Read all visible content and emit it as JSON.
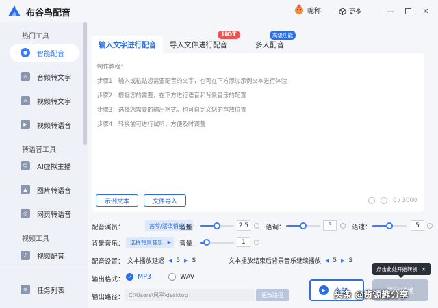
{
  "app": {
    "title": "布谷鸟配音"
  },
  "header": {
    "user_name": "昵称",
    "more_label": "更多"
  },
  "sidebar": {
    "groups": [
      {
        "title": "热门工具",
        "items": [
          "智能配音",
          "音频转文字",
          "视频转文字",
          "视频转语音"
        ]
      },
      {
        "title": "转语音工具",
        "items": [
          "AI虚拟主播",
          "图片转语音",
          "网页转语音"
        ]
      },
      {
        "title": "视频工具",
        "items": [
          "视频配音"
        ]
      }
    ],
    "bottom_item": "任务列表",
    "active_item": "智能配音"
  },
  "tabs": {
    "items": [
      "输入文字进行配音",
      "导入文件进行配音",
      "多人配音"
    ],
    "active": "输入文字进行配音",
    "hot_badge": "HOT",
    "advanced_badge": "高级功能"
  },
  "editor": {
    "tutorial": [
      "制作教程：",
      "步骤1：输入或粘贴您需要配音的文字，也可在下方添加示例文本进行体验",
      "步骤2：根据您的需要，在下方进行语音和背景音乐的配置",
      "步骤3：选择您需要的输出格式，也可自定义您的存放位置",
      "步骤4：转换前可进行试听，方便及时调整"
    ],
    "sample_button": "示例文本",
    "import_button": "文件导入",
    "char_count": "0 / 3000"
  },
  "settings": {
    "voice_label": "配音演员：",
    "voice_value": "茜兮/活泼俏皮",
    "volume_label": "音量：",
    "volume_value": "2.5",
    "volume_level": 0.5,
    "tone_label": "语调：",
    "tone_value": "5",
    "tone_level": 0.5,
    "speed_label": "语速：",
    "speed_value": "5",
    "speed_level": 0.5,
    "bgm_label": "背景音乐：",
    "bgm_value": "选择背景音乐",
    "bgm_volume_label": "音量：",
    "bgm_volume_value": "1",
    "bgm_volume_level": 0.2,
    "config_label": "配音设置：",
    "start_delay_label": "文本播放延迟",
    "start_delay_value": "5",
    "end_delay_label": "文本播放结束后背景音乐继续播放",
    "end_delay_value": "5",
    "unit": "S",
    "format_label": "输出格式：",
    "format_options": [
      "MP3",
      "WAV"
    ],
    "format_selected": "MP3",
    "path_label": "输出路径：",
    "path_value": "C:\\Users\\风平\\desktop",
    "path_button": "更改路径"
  },
  "actions": {
    "play_all": "全部",
    "start": "开始转换",
    "tooltip": "点击此处开始转换"
  },
  "watermark": "头条 @资源趣分享",
  "colors": {
    "accent": "#2b6fe8",
    "hot": "#f0524f"
  }
}
